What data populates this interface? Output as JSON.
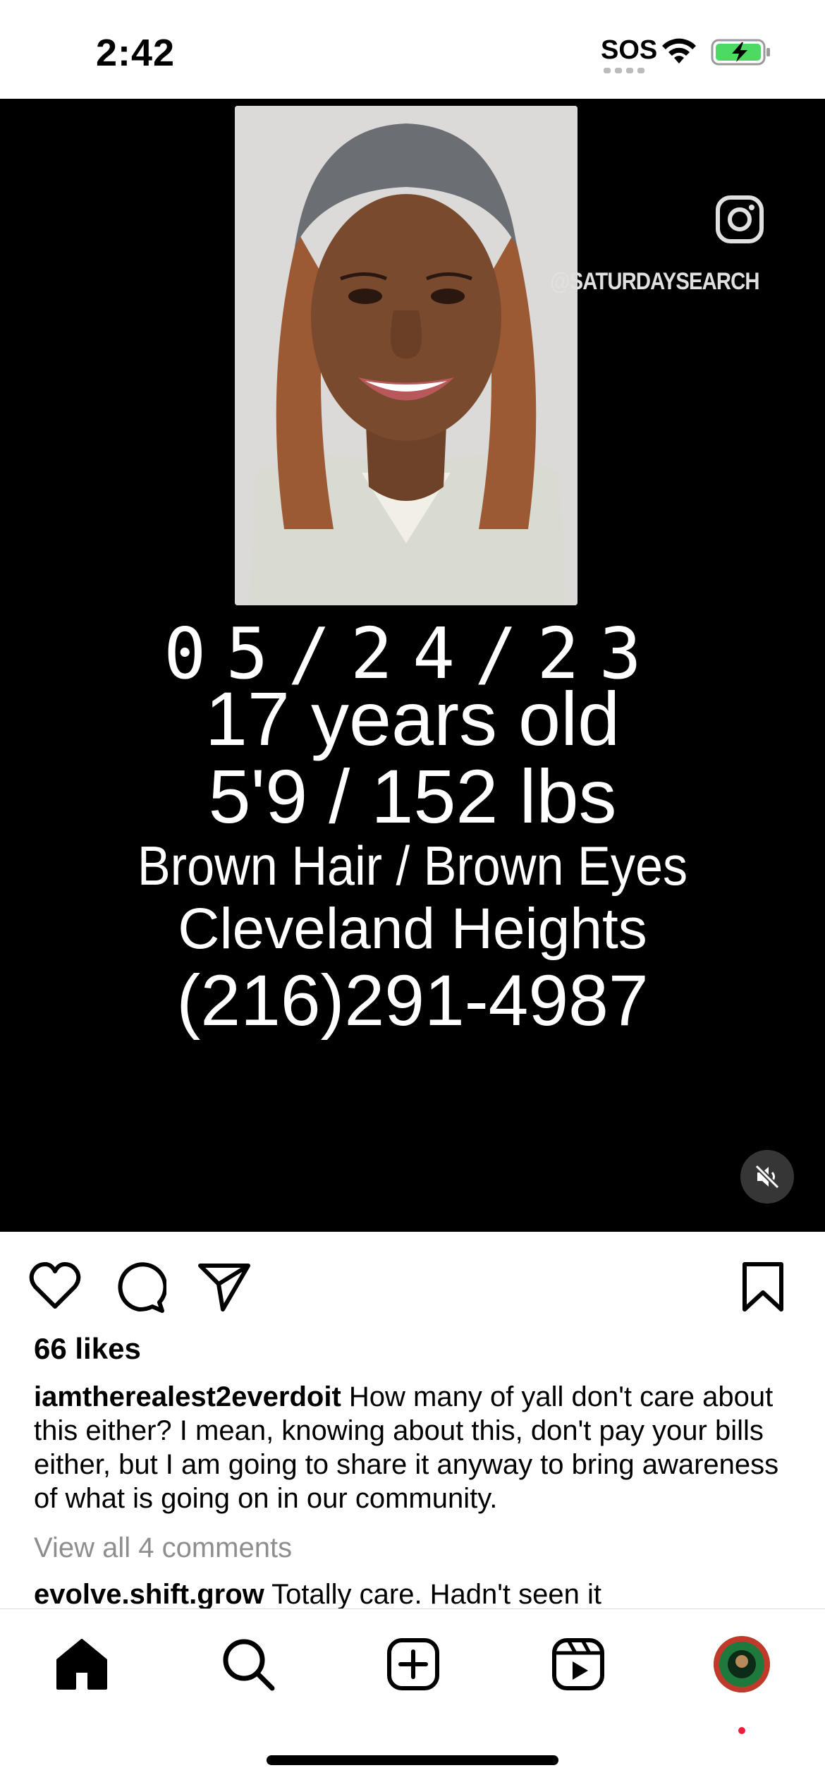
{
  "status_bar": {
    "time": "2:42",
    "sos": "SOS"
  },
  "media": {
    "watermark_handle": "@SATURDAYSEARCH",
    "lines": {
      "date": "05/24/23",
      "age": "17 years old",
      "size": "5'9 / 152 lbs",
      "hair_eyes": "Brown Hair / Brown Eyes",
      "city": "Cleveland Heights",
      "phone": "(216)291-4987"
    },
    "muted": true
  },
  "post": {
    "likes": "66 likes",
    "caption_user": "iamtherealest2everdoit",
    "caption_text": "How many of yall don't care about this either? I mean, knowing about this, don't pay your bills either, but I am going to share it anyway to bring awareness of what is going on in our community.",
    "view_comments": "View all 4 comments",
    "comment_user": "evolve.shift.grow",
    "comment_text": "Totally care. Hadn't seen it"
  },
  "tabs": [
    "home",
    "search",
    "create",
    "reels",
    "profile"
  ],
  "colors": {
    "accent_red": "#ed1c3a",
    "battery_green": "#4cd964",
    "muted_gray": "#8e8e8e"
  }
}
